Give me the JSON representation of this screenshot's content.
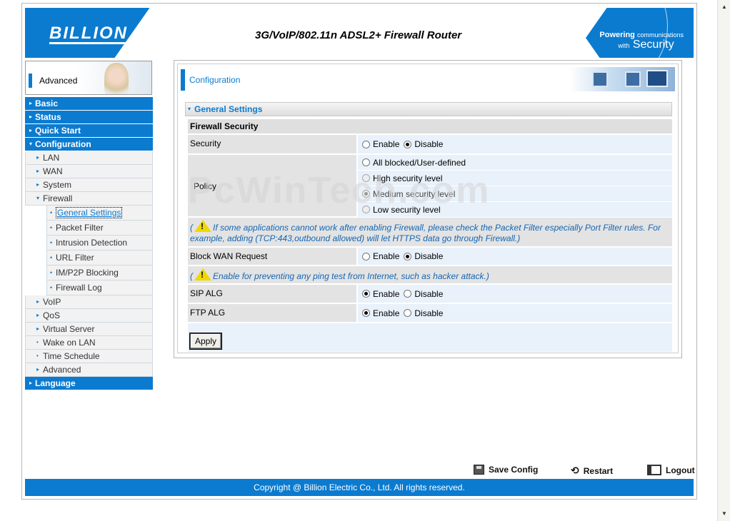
{
  "header": {
    "logo": "BILLION",
    "title": "3G/VoIP/802.11n ADSL2+ Firewall Router",
    "tagline_bold": "Powering",
    "tagline_small": "communications",
    "tagline_with": "with",
    "tagline_security": "Security"
  },
  "mode_label": "Advanced",
  "menu": {
    "basic": "Basic",
    "status": "Status",
    "quick_start": "Quick Start",
    "configuration": "Configuration",
    "lan": "LAN",
    "wan": "WAN",
    "system": "System",
    "firewall": "Firewall",
    "general_settings": "General Settings",
    "packet_filter": "Packet Filter",
    "intrusion_detection": "Intrusion Detection",
    "url_filter": "URL Filter",
    "im_p2p_blocking": "IM/P2P Blocking",
    "firewall_log": "Firewall Log",
    "voip": "VoIP",
    "qos": "QoS",
    "virtual_server": "Virtual Server",
    "wake_on_lan": "Wake on LAN",
    "time_schedule": "Time Schedule",
    "advanced": "Advanced",
    "language": "Language"
  },
  "page_title": "Configuration",
  "section_title": "General Settings",
  "form": {
    "firewall_security_header": "Firewall Security",
    "enable": "Enable",
    "disable": "Disable",
    "security_label": "Security",
    "security_value": "Disable",
    "policy_label": "Policy",
    "policy_options": [
      "All blocked/User-defined",
      "High security level",
      "Medium security level",
      "Low security level"
    ],
    "policy_selected": "Medium security level",
    "firewall_note": "If some applications cannot work after enabling Firewall, please check the Packet Filter especially Port Filter rules. For example, adding (TCP:443,outbound allowed) will let HTTPS data go through Firewall.)",
    "block_wan_label": "Block WAN Request",
    "block_wan_value": "Disable",
    "ping_note": "Enable for preventing any ping test from Internet, such as hacker attack.)",
    "sip_alg_label": "SIP ALG",
    "sip_alg_value": "Enable",
    "ftp_alg_label": "FTP ALG",
    "ftp_alg_value": "Enable",
    "paren_open": "(",
    "warn_glyph": "!",
    "apply": "Apply"
  },
  "watermark": "PcWinTech.com",
  "footer": {
    "save_config": "Save Config",
    "restart": "Restart",
    "logout": "Logout",
    "copyright": "Copyright @ Billion Electric Co., Ltd. All rights reserved."
  },
  "colors": {
    "brand_blue": "#0b7bd0",
    "note_text": "#1466b3"
  }
}
